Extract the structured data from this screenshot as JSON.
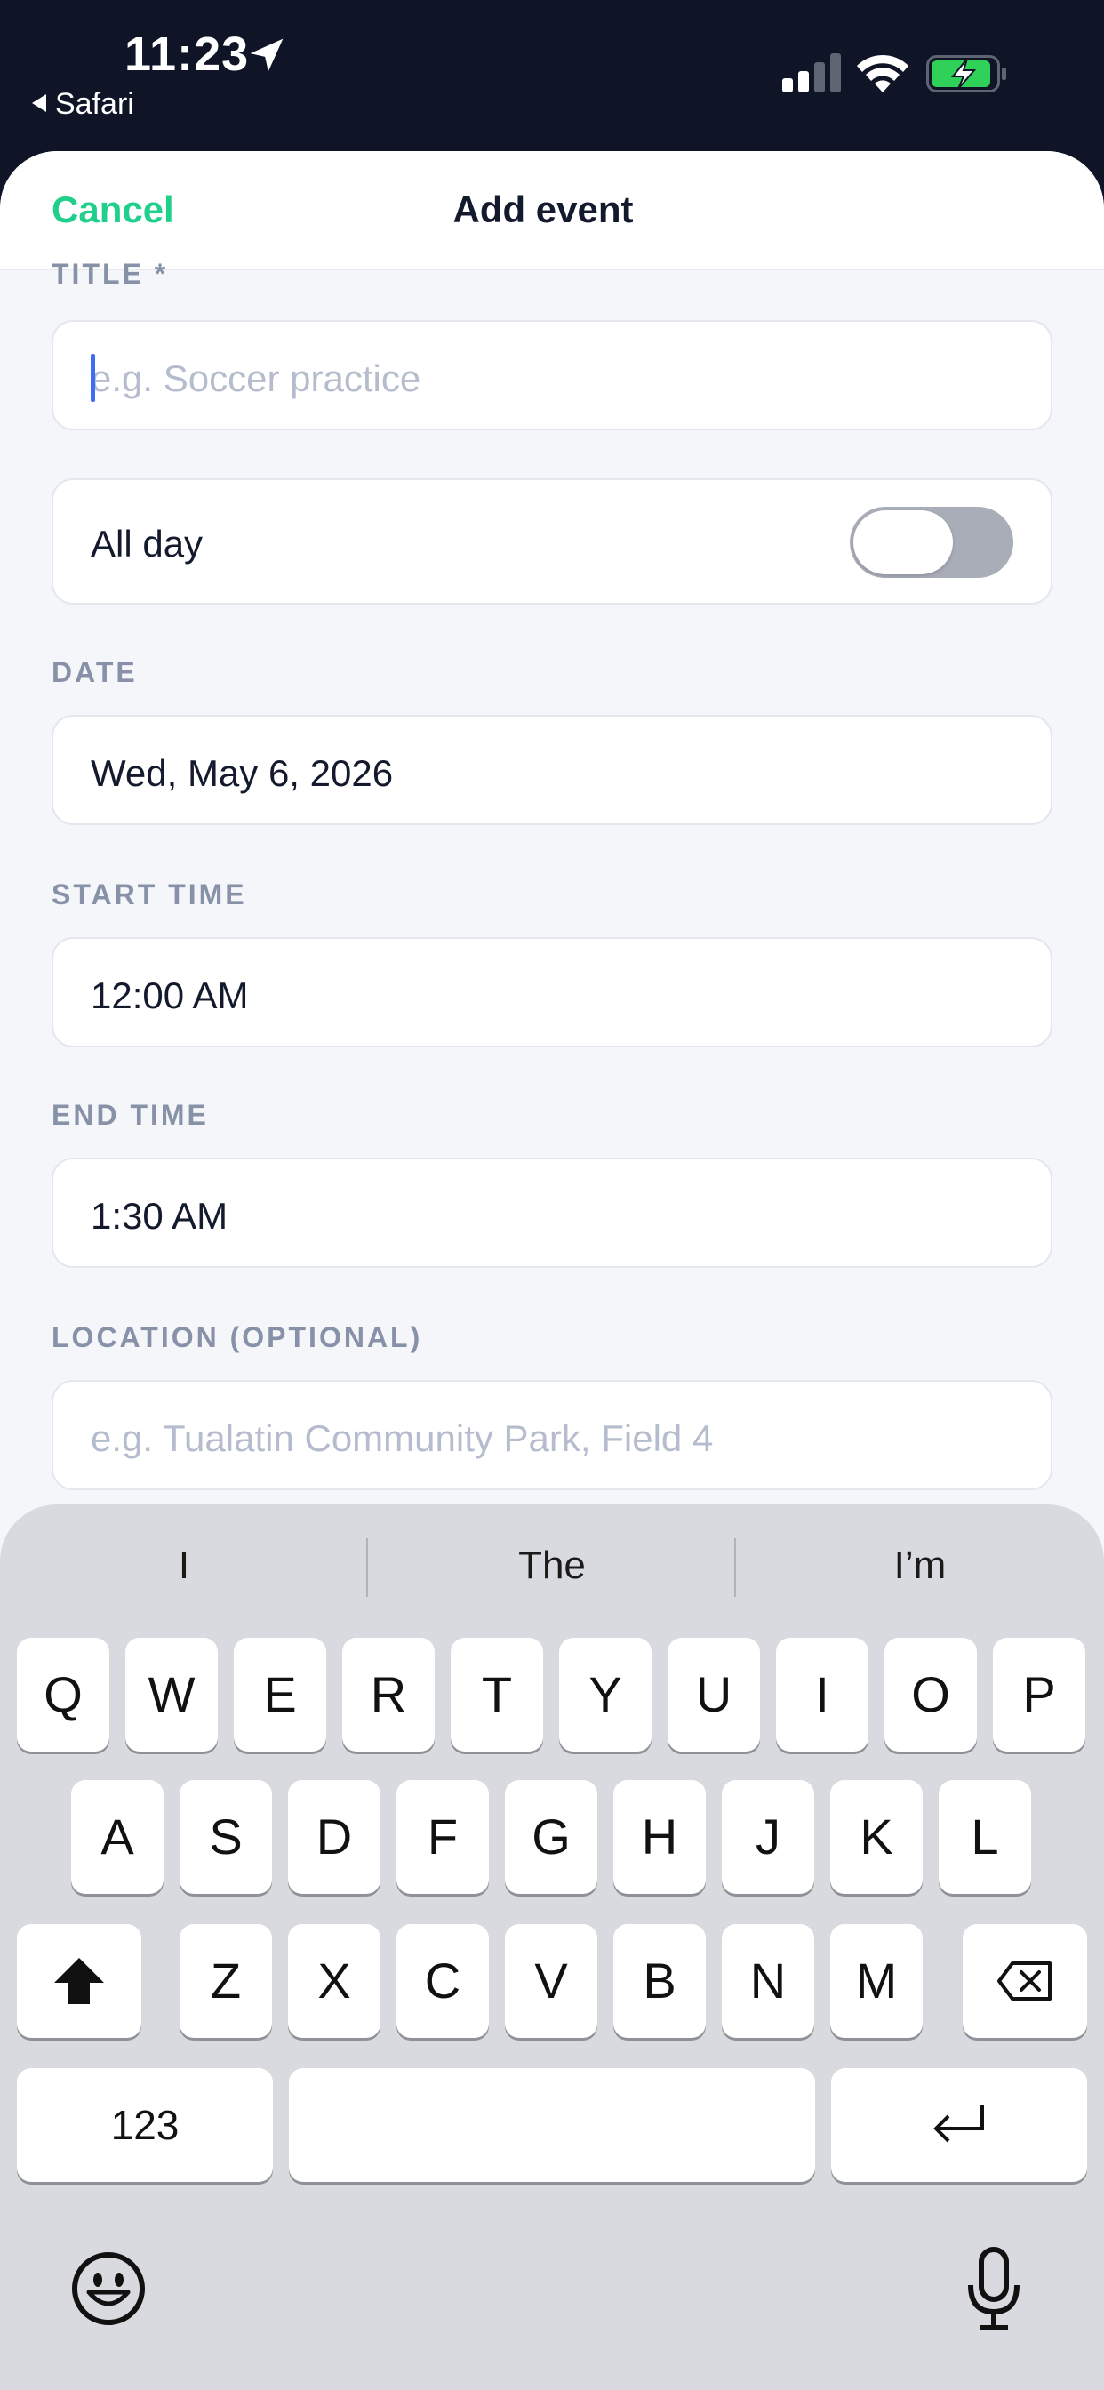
{
  "status": {
    "time": "11:23",
    "back_app": "Safari"
  },
  "nav": {
    "cancel": "Cancel",
    "title": "Add event"
  },
  "form": {
    "title_label": "TITLE *",
    "title_placeholder": "e.g. Soccer practice",
    "all_day_label": "All day",
    "all_day_on": false,
    "date_label": "DATE",
    "date_value": "Wed, May 6, 2026",
    "start_label": "START TIME",
    "start_value": "12:00 AM",
    "end_label": "END TIME",
    "end_value": "1:30 AM",
    "location_label": "LOCATION (OPTIONAL)",
    "location_placeholder": "e.g. Tualatin Community Park, Field 4"
  },
  "keyboard": {
    "suggestions": [
      "I",
      "The",
      "I’m"
    ],
    "row1": [
      "Q",
      "W",
      "E",
      "R",
      "T",
      "Y",
      "U",
      "I",
      "O",
      "P"
    ],
    "row2": [
      "A",
      "S",
      "D",
      "F",
      "G",
      "H",
      "J",
      "K",
      "L"
    ],
    "row3": [
      "Z",
      "X",
      "C",
      "V",
      "B",
      "N",
      "M"
    ],
    "numbers_key": "123"
  },
  "colors": {
    "accent": "#1fcf8a",
    "caret": "#3b6ef5",
    "dark": "#0f1426"
  }
}
